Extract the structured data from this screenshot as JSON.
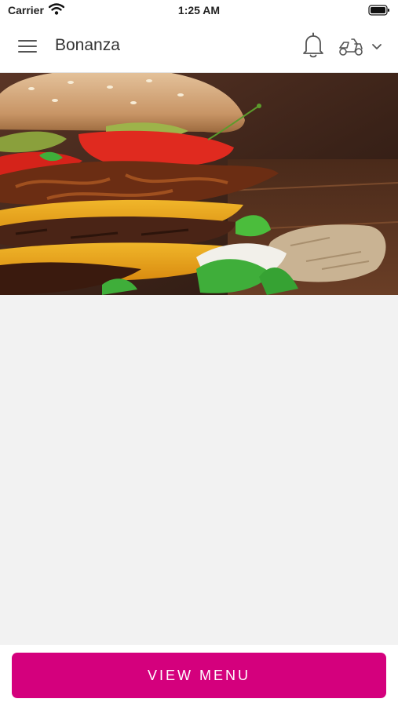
{
  "status_bar": {
    "carrier": "Carrier",
    "time": "1:25 AM",
    "wifi_icon": "wifi-icon",
    "battery_icon": "battery-icon"
  },
  "nav": {
    "restaurant_name": "Bonanza",
    "menu_icon": "hamburger-menu-icon",
    "notifications_icon": "bell-icon",
    "order_mode_icon": "delivery-scooter-icon",
    "dropdown_icon": "chevron-down-icon"
  },
  "hero": {
    "image": "burger-photo"
  },
  "actions": {
    "view_menu_label": "VIEW MENU"
  },
  "colors": {
    "accent": "#d4007d",
    "background": "#f2f2f2",
    "header": "#ffffff",
    "icon": "#555555"
  }
}
